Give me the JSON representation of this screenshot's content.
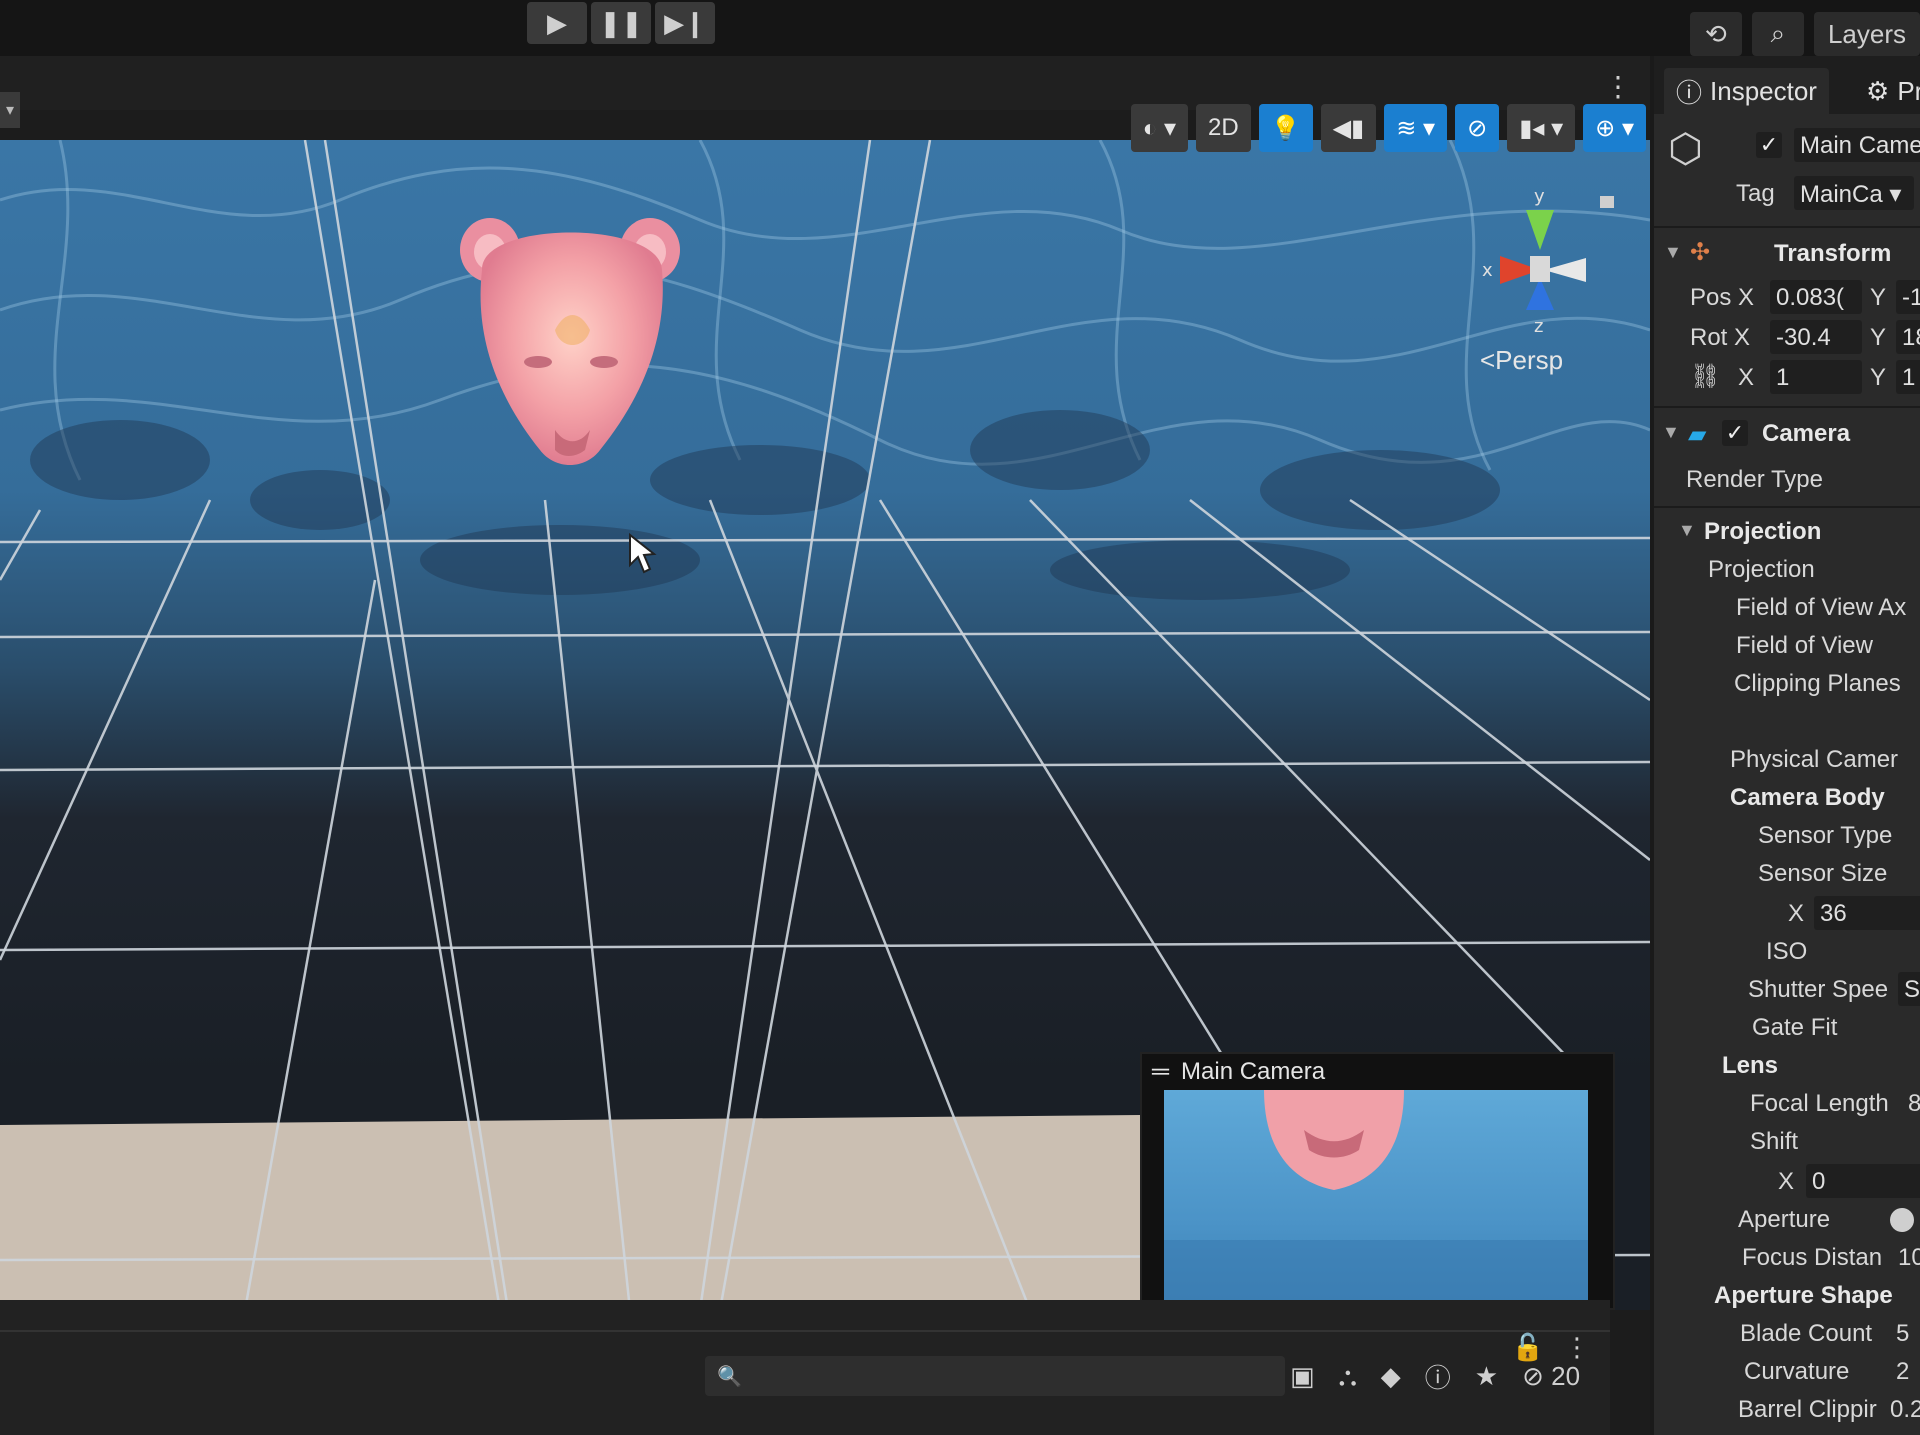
{
  "toolbar": {
    "play_icon": "play-icon",
    "pause_icon": "pause-icon",
    "step_icon": "step-icon",
    "history_icon": "history-icon",
    "search_icon": "search-icon",
    "layers_label": "Layers"
  },
  "scene": {
    "tools": {
      "shading_icon": "shading-mode-icon",
      "mode_2d": "2D",
      "lighting_icon": "lighting-icon",
      "audio_icon": "audio-icon",
      "effects_icon": "effects-icon",
      "hidden_icon": "visibility-icon",
      "camera_icon": "camera-settings-icon",
      "gizmos_icon": "gizmos-icon"
    },
    "gizmo": {
      "x": "x",
      "y": "y",
      "z": "z",
      "persp": "<Persp"
    },
    "preview_title": "Main Camera"
  },
  "bottom": {
    "lock_icon": "lock-icon",
    "menu_icon": "more-icon",
    "hidden_count": "20"
  },
  "inspector": {
    "tab_inspector": "Inspector",
    "tab_project": "Pr",
    "object_name": "Main Came",
    "tag_label": "Tag",
    "tag_value": "MainCa",
    "transform": {
      "title": "Transform",
      "pos_label": "Pos X",
      "pos_x": "0.083(",
      "pos_y_label": "Y",
      "pos_y": "-1",
      "rot_label": "Rot X",
      "rot_x": "-30.4",
      "rot_y_label": "Y",
      "rot_y": "18",
      "scale_x_label": "X",
      "scale_x": "1",
      "scale_y_label": "Y",
      "scale_y": "1"
    },
    "camera": {
      "title": "Camera",
      "render_type": "Render Type",
      "projection_header": "Projection",
      "projection": "Projection",
      "fov_axis": "Field of View Ax",
      "fov": "Field of View",
      "clipping": "Clipping Planes",
      "physical": "Physical Camer",
      "camera_body": "Camera Body",
      "sensor_type": "Sensor Type",
      "sensor_size": "Sensor Size",
      "sensor_x_label": "X",
      "sensor_x": "36",
      "iso": "ISO",
      "shutter": "Shutter Spee",
      "shutter_value": "Sc",
      "gate_fit": "Gate Fit",
      "lens": "Lens",
      "focal_length": "Focal Length",
      "focal_value": "8",
      "shift": "Shift",
      "shift_x_label": "X",
      "shift_x": "0",
      "aperture": "Aperture",
      "focus_distance": "Focus Distan",
      "focus_value": "10",
      "aperture_shape": "Aperture Shape",
      "blade_count": "Blade Count",
      "blade_value": "5",
      "curvature": "Curvature",
      "curvature_value": "2",
      "barrel_clipping": "Barrel Clippir",
      "barrel_value": "0.2"
    }
  }
}
